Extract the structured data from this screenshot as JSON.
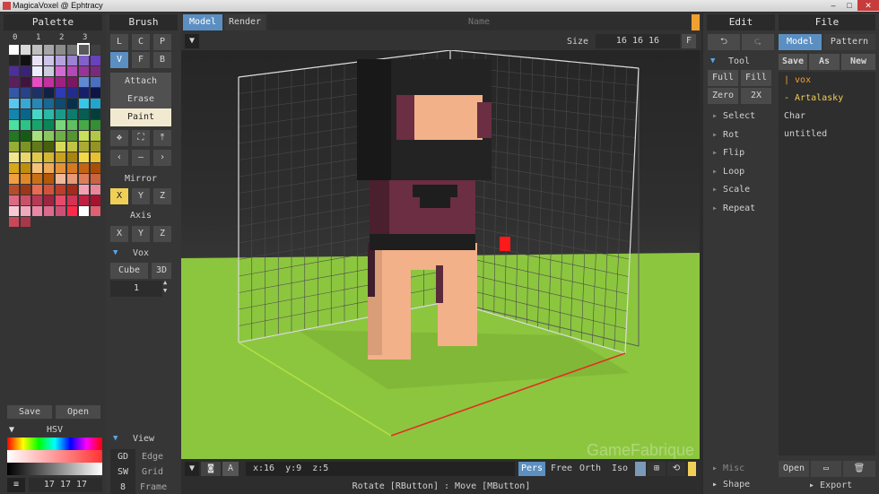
{
  "window": {
    "title": "MagicaVoxel @ Ephtracy"
  },
  "palette": {
    "header": "Palette",
    "pages": [
      "0",
      "1",
      "2",
      "3"
    ],
    "save_label": "Save",
    "open_label": "Open",
    "hsv_label": "HSV",
    "rgb_value": "17 17 17",
    "colors": [
      "#ffffff",
      "#d9d9d9",
      "#bfbfbf",
      "#a6a6a6",
      "#8c8c8c",
      "#737373",
      "#595959",
      "#404040",
      "#262626",
      "#111111",
      "#e9e4f5",
      "#cfc3ea",
      "#b5a2df",
      "#9b82d4",
      "#8161c9",
      "#6741be",
      "#4d2e9a",
      "#3a2277",
      "#eef",
      "#ccd",
      "#d36ad3",
      "#b548b5",
      "#973597",
      "#7a2a7a",
      "#5c1f5c",
      "#3f143f",
      "#e84cc4",
      "#c2319f",
      "#a21f82",
      "#7d1662",
      "#5f89d3",
      "#4a6fc0",
      "#3557a8",
      "#274287",
      "#1d3166",
      "#132045",
      "#2d3bb4",
      "#222c8e",
      "#181f68",
      "#0f1445",
      "#58c8f0",
      "#3aa6d6",
      "#2687b8",
      "#176894",
      "#0d4b70",
      "#06304c",
      "#36c6e8",
      "#21a5cc",
      "#1386ad",
      "#0a658a",
      "#47d6c4",
      "#2ab8a7",
      "#1a9a8b",
      "#0d7c6f",
      "#065e53",
      "#033f38",
      "#4ae0a0",
      "#2ac487",
      "#17a56e",
      "#0a8656",
      "#7ad67a",
      "#5ec05e",
      "#47a847",
      "#338f33",
      "#237623",
      "#145c14",
      "#a7e07a",
      "#8ac85e",
      "#6eae47",
      "#549433",
      "#c9e05a",
      "#b0c845",
      "#96ae33",
      "#7c9423",
      "#627a17",
      "#49600d",
      "#d8d85a",
      "#c2c245",
      "#abab33",
      "#949423",
      "#f0e68c",
      "#e8d86a",
      "#e0c84a",
      "#d4b630",
      "#c8a21c",
      "#a8860e",
      "#f5d848",
      "#e8c030",
      "#d8a81c",
      "#c08e0e",
      "#f5c27a",
      "#eeaa58",
      "#e4923a",
      "#d67a22",
      "#c46412",
      "#a84e08",
      "#f0a040",
      "#e08828",
      "#cc7016",
      "#b4580a",
      "#f2b89a",
      "#e89a78",
      "#dc7e5a",
      "#cc6440",
      "#b84c2a",
      "#9c3818",
      "#e86a50",
      "#d4523a",
      "#be3c28",
      "#a42a1a",
      "#f2a2b2",
      "#e8869a",
      "#dc6a82",
      "#cc506a",
      "#b83a54",
      "#9c2640",
      "#e84a6a",
      "#d43454",
      "#be2240",
      "#a4142e",
      "#f8c8d4",
      "#f0a8bc",
      "#e888a4",
      "#dc6a8c",
      "#cc5074",
      "#ff2a4a",
      "#ffffff",
      "#e06070",
      "#c84858",
      "#a83848"
    ],
    "sel_text": "≡",
    "rgb": "17 17 17"
  },
  "brush": {
    "header": "Brush",
    "modes": [
      "L",
      "C",
      "P",
      "V",
      "F",
      "B"
    ],
    "actions": [
      "Attach",
      "Erase",
      "Paint"
    ],
    "mirror_label": "Mirror",
    "axis_label": "Axis",
    "mirror_axes": [
      "X",
      "Y",
      "Z"
    ],
    "axis_axes": [
      "X",
      "Y",
      "Z"
    ],
    "vox_label": "Vox",
    "cube_label": "Cube",
    "threed_label": "3D",
    "count": "1",
    "view_label": "View",
    "view_rows": [
      [
        "GD",
        "Edge"
      ],
      [
        "SW",
        "Grid"
      ],
      [
        "8",
        "Frame"
      ]
    ]
  },
  "viewport": {
    "tabs": [
      "Model",
      "Render"
    ],
    "name_placeholder": "Name",
    "size_label": "Size",
    "size_value": "16 16 16",
    "f_label": "F",
    "coords": [
      "x:16",
      "y:9",
      "z:5"
    ],
    "cam_buttons": [
      "Pers",
      "Free",
      "Orth",
      "Iso"
    ],
    "a_label": "A",
    "status": "Rotate [RButton] : Move [MButton]"
  },
  "edit": {
    "header": "Edit",
    "tool_label": "Tool",
    "tool_buttons": [
      [
        "Full",
        "Fill"
      ],
      [
        "Zero",
        "2X"
      ]
    ],
    "items": [
      "Select",
      "Rot",
      "Flip",
      "Loop",
      "Scale",
      "Repeat"
    ],
    "bottom_items": [
      "Misc",
      "Shape"
    ]
  },
  "file": {
    "header": "File",
    "tabs": [
      "Model",
      "Pattern"
    ],
    "actions": [
      "Save",
      "As",
      "New"
    ],
    "list": [
      "| vox",
      "- Artalasky",
      "Char",
      "untitled"
    ],
    "bottom_open": "Open",
    "export_label": "Export"
  },
  "watermark": "GameFabrique",
  "colors": {
    "accent_yellow": "#f0cf57",
    "accent_blue": "#5b8fc2",
    "ground": "#8cc63f"
  }
}
